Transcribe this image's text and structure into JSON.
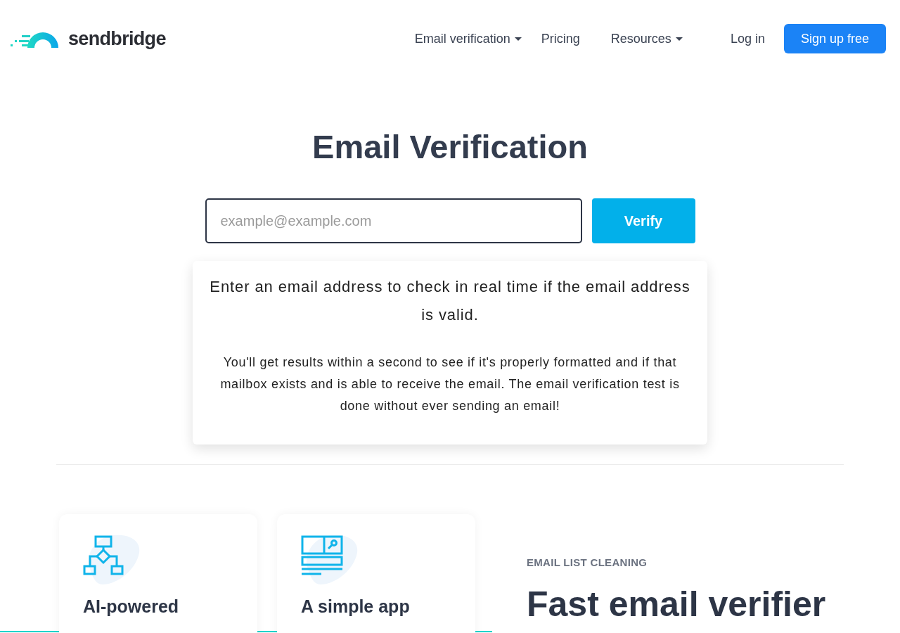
{
  "header": {
    "logo": {
      "text": "sendbridge"
    },
    "nav": [
      {
        "label": "Email verification",
        "kind": "dropdown"
      },
      {
        "label": "Pricing",
        "kind": "link"
      },
      {
        "label": "Resources",
        "kind": "dropdown"
      }
    ],
    "login": "Log in",
    "signup": "Sign up free"
  },
  "hero": {
    "title": "Email Verification",
    "email_field": {
      "placeholder": "example@example.com"
    },
    "verify_button": "Verify",
    "info": {
      "lead": "Enter an email address to check in real time if the email address is valid.",
      "body": "You'll get results within a second to see if it's properly formatted and if that mailbox exists and is able to receive the email. The email verification test is done without ever sending an email!"
    }
  },
  "features": {
    "cards": [
      {
        "kind": "flowchart",
        "title": "AI-powered"
      },
      {
        "kind": "app-window",
        "title": "A simple app"
      }
    ]
  },
  "section": {
    "eyebrow": "EMAIL LIST CLEANING",
    "heading": "Fast email verifier"
  }
}
